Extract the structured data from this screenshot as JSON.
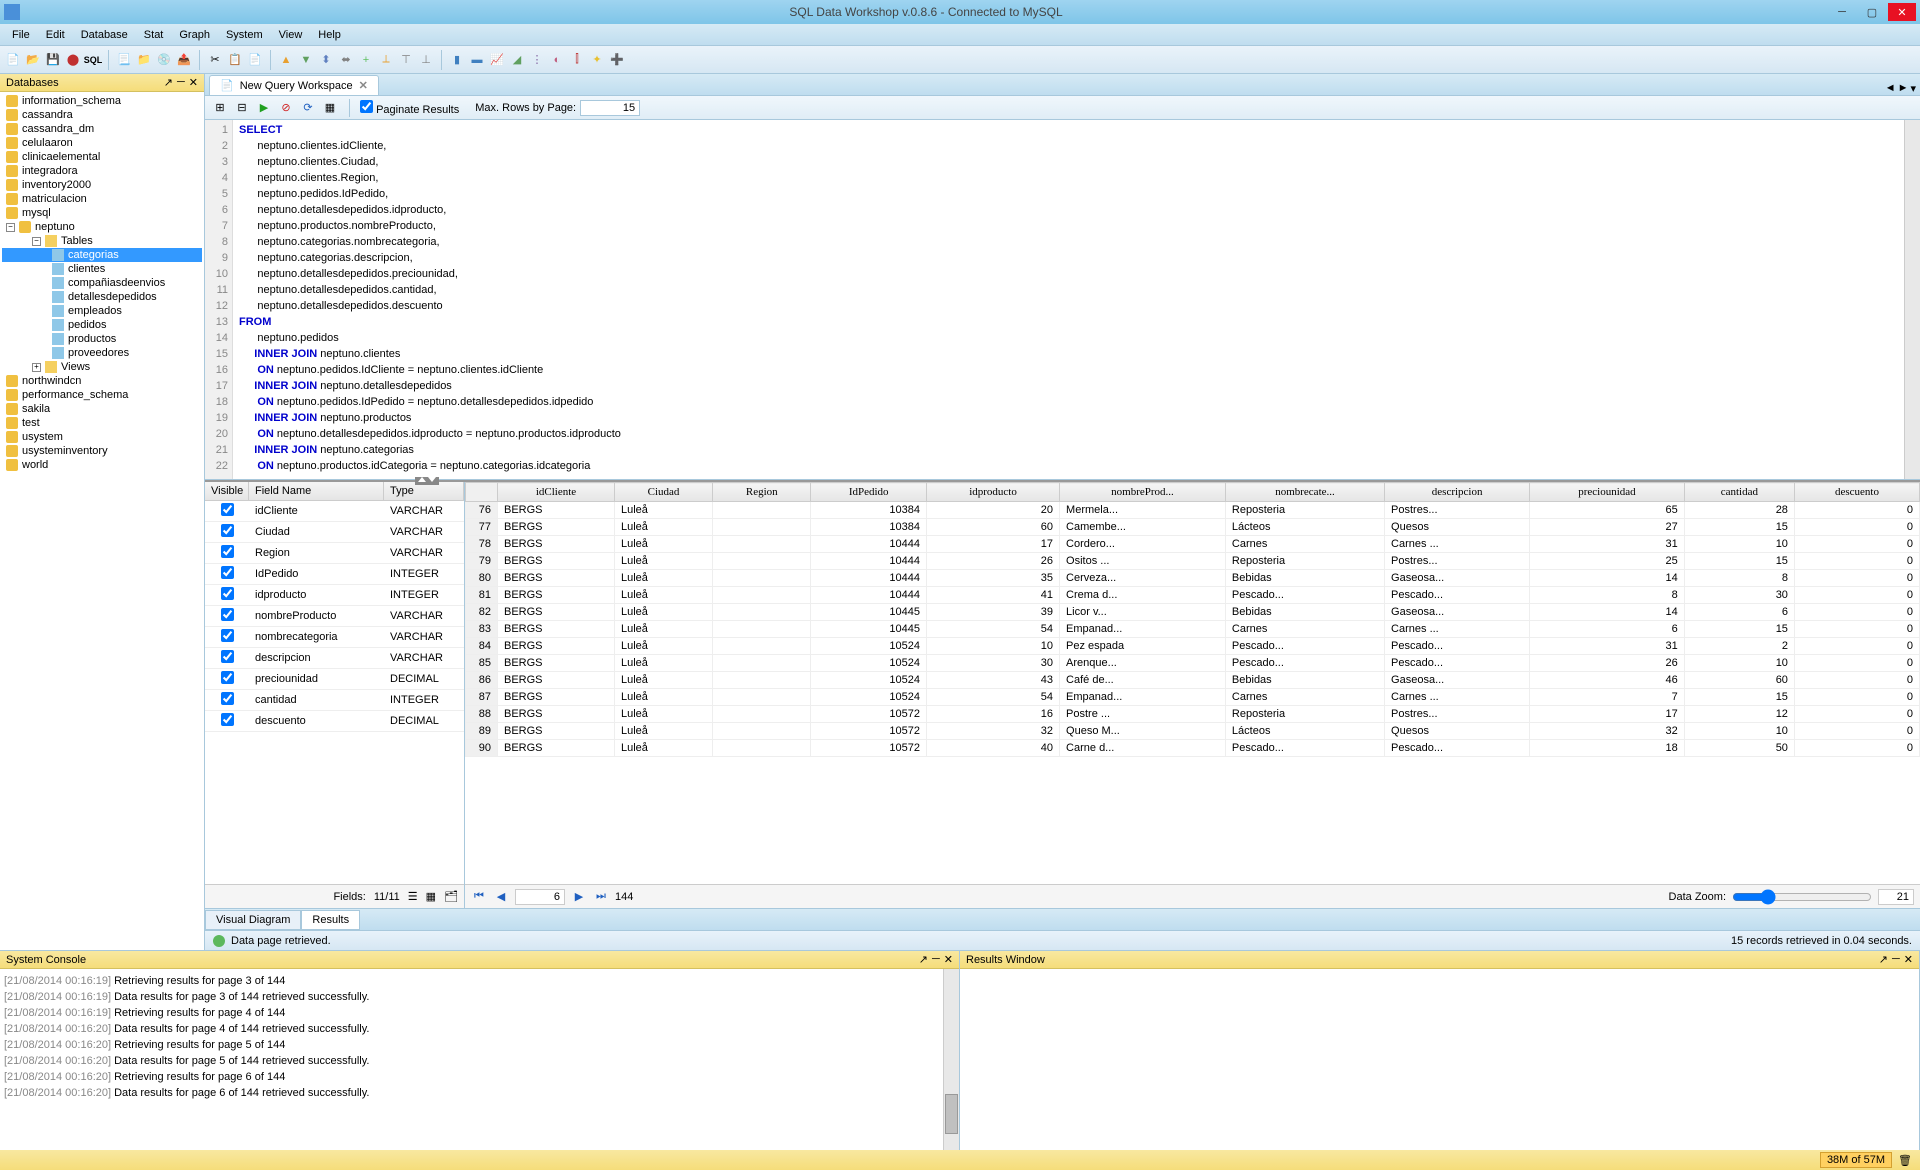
{
  "window": {
    "title": "SQL Data Workshop v.0.8.6 - Connected to MySQL"
  },
  "menus": [
    "File",
    "Edit",
    "Database",
    "Stat",
    "Graph",
    "System",
    "View",
    "Help"
  ],
  "sidebar": {
    "title": "Databases",
    "databases": [
      "information_schema",
      "cassandra",
      "cassandra_dm",
      "celulaaron",
      "clinicaelemental",
      "integradora",
      "inventory2000",
      "matriculacion",
      "mysql"
    ],
    "active_db": "neptuno",
    "tables_label": "Tables",
    "tables": [
      "categorias",
      "clientes",
      "compañiasdeenvios",
      "detallesdepedidos",
      "empleados",
      "pedidos",
      "productos",
      "proveedores"
    ],
    "views_label": "Views",
    "databases_after": [
      "northwindcn",
      "performance_schema",
      "sakila",
      "test",
      "usystem",
      "usysteminventory",
      "world"
    ]
  },
  "tab": {
    "label": "New Query Workspace"
  },
  "query_toolbar": {
    "paginate_label": "Paginate Results",
    "maxrows_label": "Max. Rows by Page:",
    "maxrows_value": "15"
  },
  "sql": {
    "lines": [
      {
        "n": 1,
        "t": "SELECT",
        "kw": true
      },
      {
        "n": 2,
        "t": "      neptuno.clientes.idCliente,"
      },
      {
        "n": 3,
        "t": "      neptuno.clientes.Ciudad,"
      },
      {
        "n": 4,
        "t": "      neptuno.clientes.Region,"
      },
      {
        "n": 5,
        "t": "      neptuno.pedidos.IdPedido,"
      },
      {
        "n": 6,
        "t": "      neptuno.detallesdepedidos.idproducto,"
      },
      {
        "n": 7,
        "t": "      neptuno.productos.nombreProducto,"
      },
      {
        "n": 8,
        "t": "      neptuno.categorias.nombrecategoria,"
      },
      {
        "n": 9,
        "t": "      neptuno.categorias.descripcion,"
      },
      {
        "n": 10,
        "t": "      neptuno.detallesdepedidos.preciounidad,"
      },
      {
        "n": 11,
        "t": "      neptuno.detallesdepedidos.cantidad,"
      },
      {
        "n": 12,
        "t": "      neptuno.detallesdepedidos.descuento"
      },
      {
        "n": 13,
        "t": "FROM",
        "kw": true
      },
      {
        "n": 14,
        "t": "      neptuno.pedidos"
      },
      {
        "n": 15,
        "t": "     INNER JOIN neptuno.clientes",
        "kw2": "INNER JOIN"
      },
      {
        "n": 16,
        "t": "      ON neptuno.pedidos.IdCliente = neptuno.clientes.idCliente",
        "kw2": "ON"
      },
      {
        "n": 17,
        "t": "     INNER JOIN neptuno.detallesdepedidos",
        "kw2": "INNER JOIN"
      },
      {
        "n": 18,
        "t": "      ON neptuno.pedidos.IdPedido = neptuno.detallesdepedidos.idpedido",
        "kw2": "ON"
      },
      {
        "n": 19,
        "t": "     INNER JOIN neptuno.productos",
        "kw2": "INNER JOIN"
      },
      {
        "n": 20,
        "t": "      ON neptuno.detallesdepedidos.idproducto = neptuno.productos.idproducto",
        "kw2": "ON"
      },
      {
        "n": 21,
        "t": "     INNER JOIN neptuno.categorias",
        "kw2": "INNER JOIN"
      },
      {
        "n": 22,
        "t": "      ON neptuno.productos.idCategoria = neptuno.categorias.idcategoria",
        "kw2": "ON"
      }
    ]
  },
  "fields": {
    "header": {
      "visible": "Visible",
      "name": "Field Name",
      "type": "Type"
    },
    "list": [
      {
        "name": "idCliente",
        "type": "VARCHAR"
      },
      {
        "name": "Ciudad",
        "type": "VARCHAR"
      },
      {
        "name": "Region",
        "type": "VARCHAR"
      },
      {
        "name": "IdPedido",
        "type": "INTEGER"
      },
      {
        "name": "idproducto",
        "type": "INTEGER"
      },
      {
        "name": "nombreProducto",
        "type": "VARCHAR"
      },
      {
        "name": "nombrecategoria",
        "type": "VARCHAR"
      },
      {
        "name": "descripcion",
        "type": "VARCHAR"
      },
      {
        "name": "preciounidad",
        "type": "DECIMAL"
      },
      {
        "name": "cantidad",
        "type": "INTEGER"
      },
      {
        "name": "descuento",
        "type": "DECIMAL"
      }
    ],
    "footer_label": "Fields:",
    "footer_count": "11/11"
  },
  "grid": {
    "columns": [
      "idCliente",
      "Ciudad",
      "Region",
      "IdPedido",
      "idproducto",
      "nombreProd...",
      "nombrecate...",
      "descripcion",
      "preciounidad",
      "cantidad",
      "descuento"
    ],
    "rows": [
      {
        "n": 76,
        "c": [
          "BERGS",
          "Luleå",
          "",
          "10384",
          "20",
          "Mermela...",
          "Reposteria",
          "Postres...",
          "65",
          "28",
          "0"
        ]
      },
      {
        "n": 77,
        "c": [
          "BERGS",
          "Luleå",
          "",
          "10384",
          "60",
          "Camembe...",
          "Lácteos",
          "Quesos",
          "27",
          "15",
          "0"
        ]
      },
      {
        "n": 78,
        "c": [
          "BERGS",
          "Luleå",
          "",
          "10444",
          "17",
          "Cordero...",
          "Carnes",
          "Carnes ...",
          "31",
          "10",
          "0"
        ]
      },
      {
        "n": 79,
        "c": [
          "BERGS",
          "Luleå",
          "",
          "10444",
          "26",
          "Ositos ...",
          "Reposteria",
          "Postres...",
          "25",
          "15",
          "0"
        ]
      },
      {
        "n": 80,
        "c": [
          "BERGS",
          "Luleå",
          "",
          "10444",
          "35",
          "Cerveza...",
          "Bebidas",
          "Gaseosa...",
          "14",
          "8",
          "0"
        ]
      },
      {
        "n": 81,
        "c": [
          "BERGS",
          "Luleå",
          "",
          "10444",
          "41",
          "Crema d...",
          "Pescado...",
          "Pescado...",
          "8",
          "30",
          "0"
        ]
      },
      {
        "n": 82,
        "c": [
          "BERGS",
          "Luleå",
          "",
          "10445",
          "39",
          "Licor v...",
          "Bebidas",
          "Gaseosa...",
          "14",
          "6",
          "0"
        ]
      },
      {
        "n": 83,
        "c": [
          "BERGS",
          "Luleå",
          "",
          "10445",
          "54",
          "Empanad...",
          "Carnes",
          "Carnes ...",
          "6",
          "15",
          "0"
        ]
      },
      {
        "n": 84,
        "c": [
          "BERGS",
          "Luleå",
          "",
          "10524",
          "10",
          "Pez espada",
          "Pescado...",
          "Pescado...",
          "31",
          "2",
          "0"
        ]
      },
      {
        "n": 85,
        "c": [
          "BERGS",
          "Luleå",
          "",
          "10524",
          "30",
          "Arenque...",
          "Pescado...",
          "Pescado...",
          "26",
          "10",
          "0"
        ]
      },
      {
        "n": 86,
        "c": [
          "BERGS",
          "Luleå",
          "",
          "10524",
          "43",
          "Café de...",
          "Bebidas",
          "Gaseosa...",
          "46",
          "60",
          "0"
        ]
      },
      {
        "n": 87,
        "c": [
          "BERGS",
          "Luleå",
          "",
          "10524",
          "54",
          "Empanad...",
          "Carnes",
          "Carnes ...",
          "7",
          "15",
          "0"
        ]
      },
      {
        "n": 88,
        "c": [
          "BERGS",
          "Luleå",
          "",
          "10572",
          "16",
          "Postre ...",
          "Reposteria",
          "Postres...",
          "17",
          "12",
          "0"
        ]
      },
      {
        "n": 89,
        "c": [
          "BERGS",
          "Luleå",
          "",
          "10572",
          "32",
          "Queso M...",
          "Lácteos",
          "Quesos",
          "32",
          "10",
          "0"
        ]
      },
      {
        "n": 90,
        "c": [
          "BERGS",
          "Luleå",
          "",
          "10572",
          "40",
          "Carne d...",
          "Pescado...",
          "Pescado...",
          "18",
          "50",
          "0"
        ]
      }
    ]
  },
  "pager": {
    "page": "6",
    "total": "144",
    "zoom_label": "Data Zoom:",
    "zoom_value": "21"
  },
  "bottom_tabs": {
    "visual": "Visual Diagram",
    "results": "Results"
  },
  "status": {
    "msg": "Data page retrieved.",
    "summary": "15 records retrieved in 0.04 seconds."
  },
  "console": {
    "title": "System Console",
    "lines": [
      {
        "ts": "[21/08/2014 00:16:19]",
        "msg": "Retrieving results for page 3 of 144"
      },
      {
        "ts": "[21/08/2014 00:16:19]",
        "msg": "Data results for page 3 of 144 retrieved successfully."
      },
      {
        "ts": "[21/08/2014 00:16:19]",
        "msg": "Retrieving results for page 4 of 144"
      },
      {
        "ts": "[21/08/2014 00:16:20]",
        "msg": "Data results for page 4 of 144 retrieved successfully."
      },
      {
        "ts": "[21/08/2014 00:16:20]",
        "msg": "Retrieving results for page 5 of 144"
      },
      {
        "ts": "[21/08/2014 00:16:20]",
        "msg": "Data results for page 5 of 144 retrieved successfully."
      },
      {
        "ts": "[21/08/2014 00:16:20]",
        "msg": "Retrieving results for page 6 of 144"
      },
      {
        "ts": "[21/08/2014 00:16:20]",
        "msg": "Data results for page 6 of 144 retrieved successfully."
      }
    ]
  },
  "results_window": {
    "title": "Results Window"
  },
  "statusbar": {
    "memory": "38M of 57M"
  }
}
